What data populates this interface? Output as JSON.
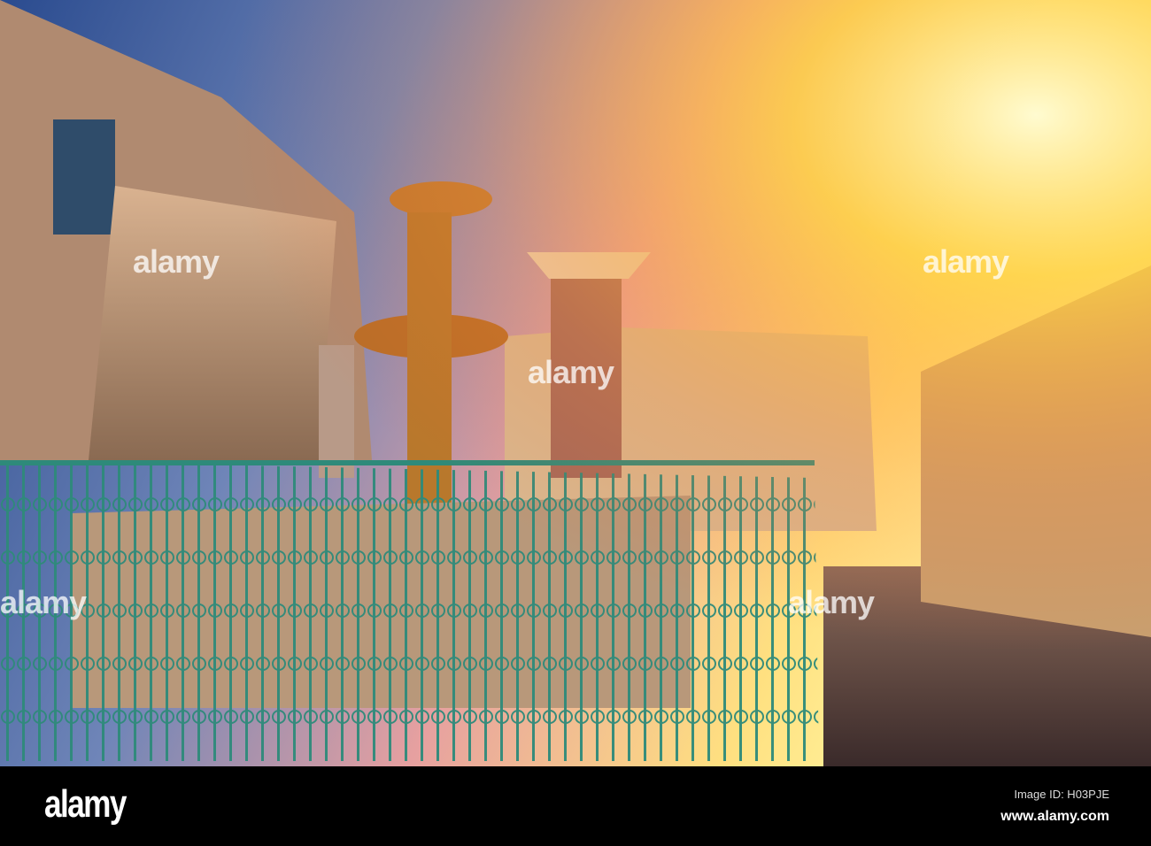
{
  "photo": {
    "subject": "fountain-with-green-iron-fence-in-old-city-square",
    "sky_color": "#3a5a9a",
    "sun_color": "#ffe040",
    "fence_color": "#2e8a7a",
    "stone_color": "#c9a07a"
  },
  "watermark": {
    "text": "alamy"
  },
  "footer": {
    "logo": "alamy",
    "image_id": "Image ID: H03PJE",
    "url": "www.alamy.com"
  }
}
